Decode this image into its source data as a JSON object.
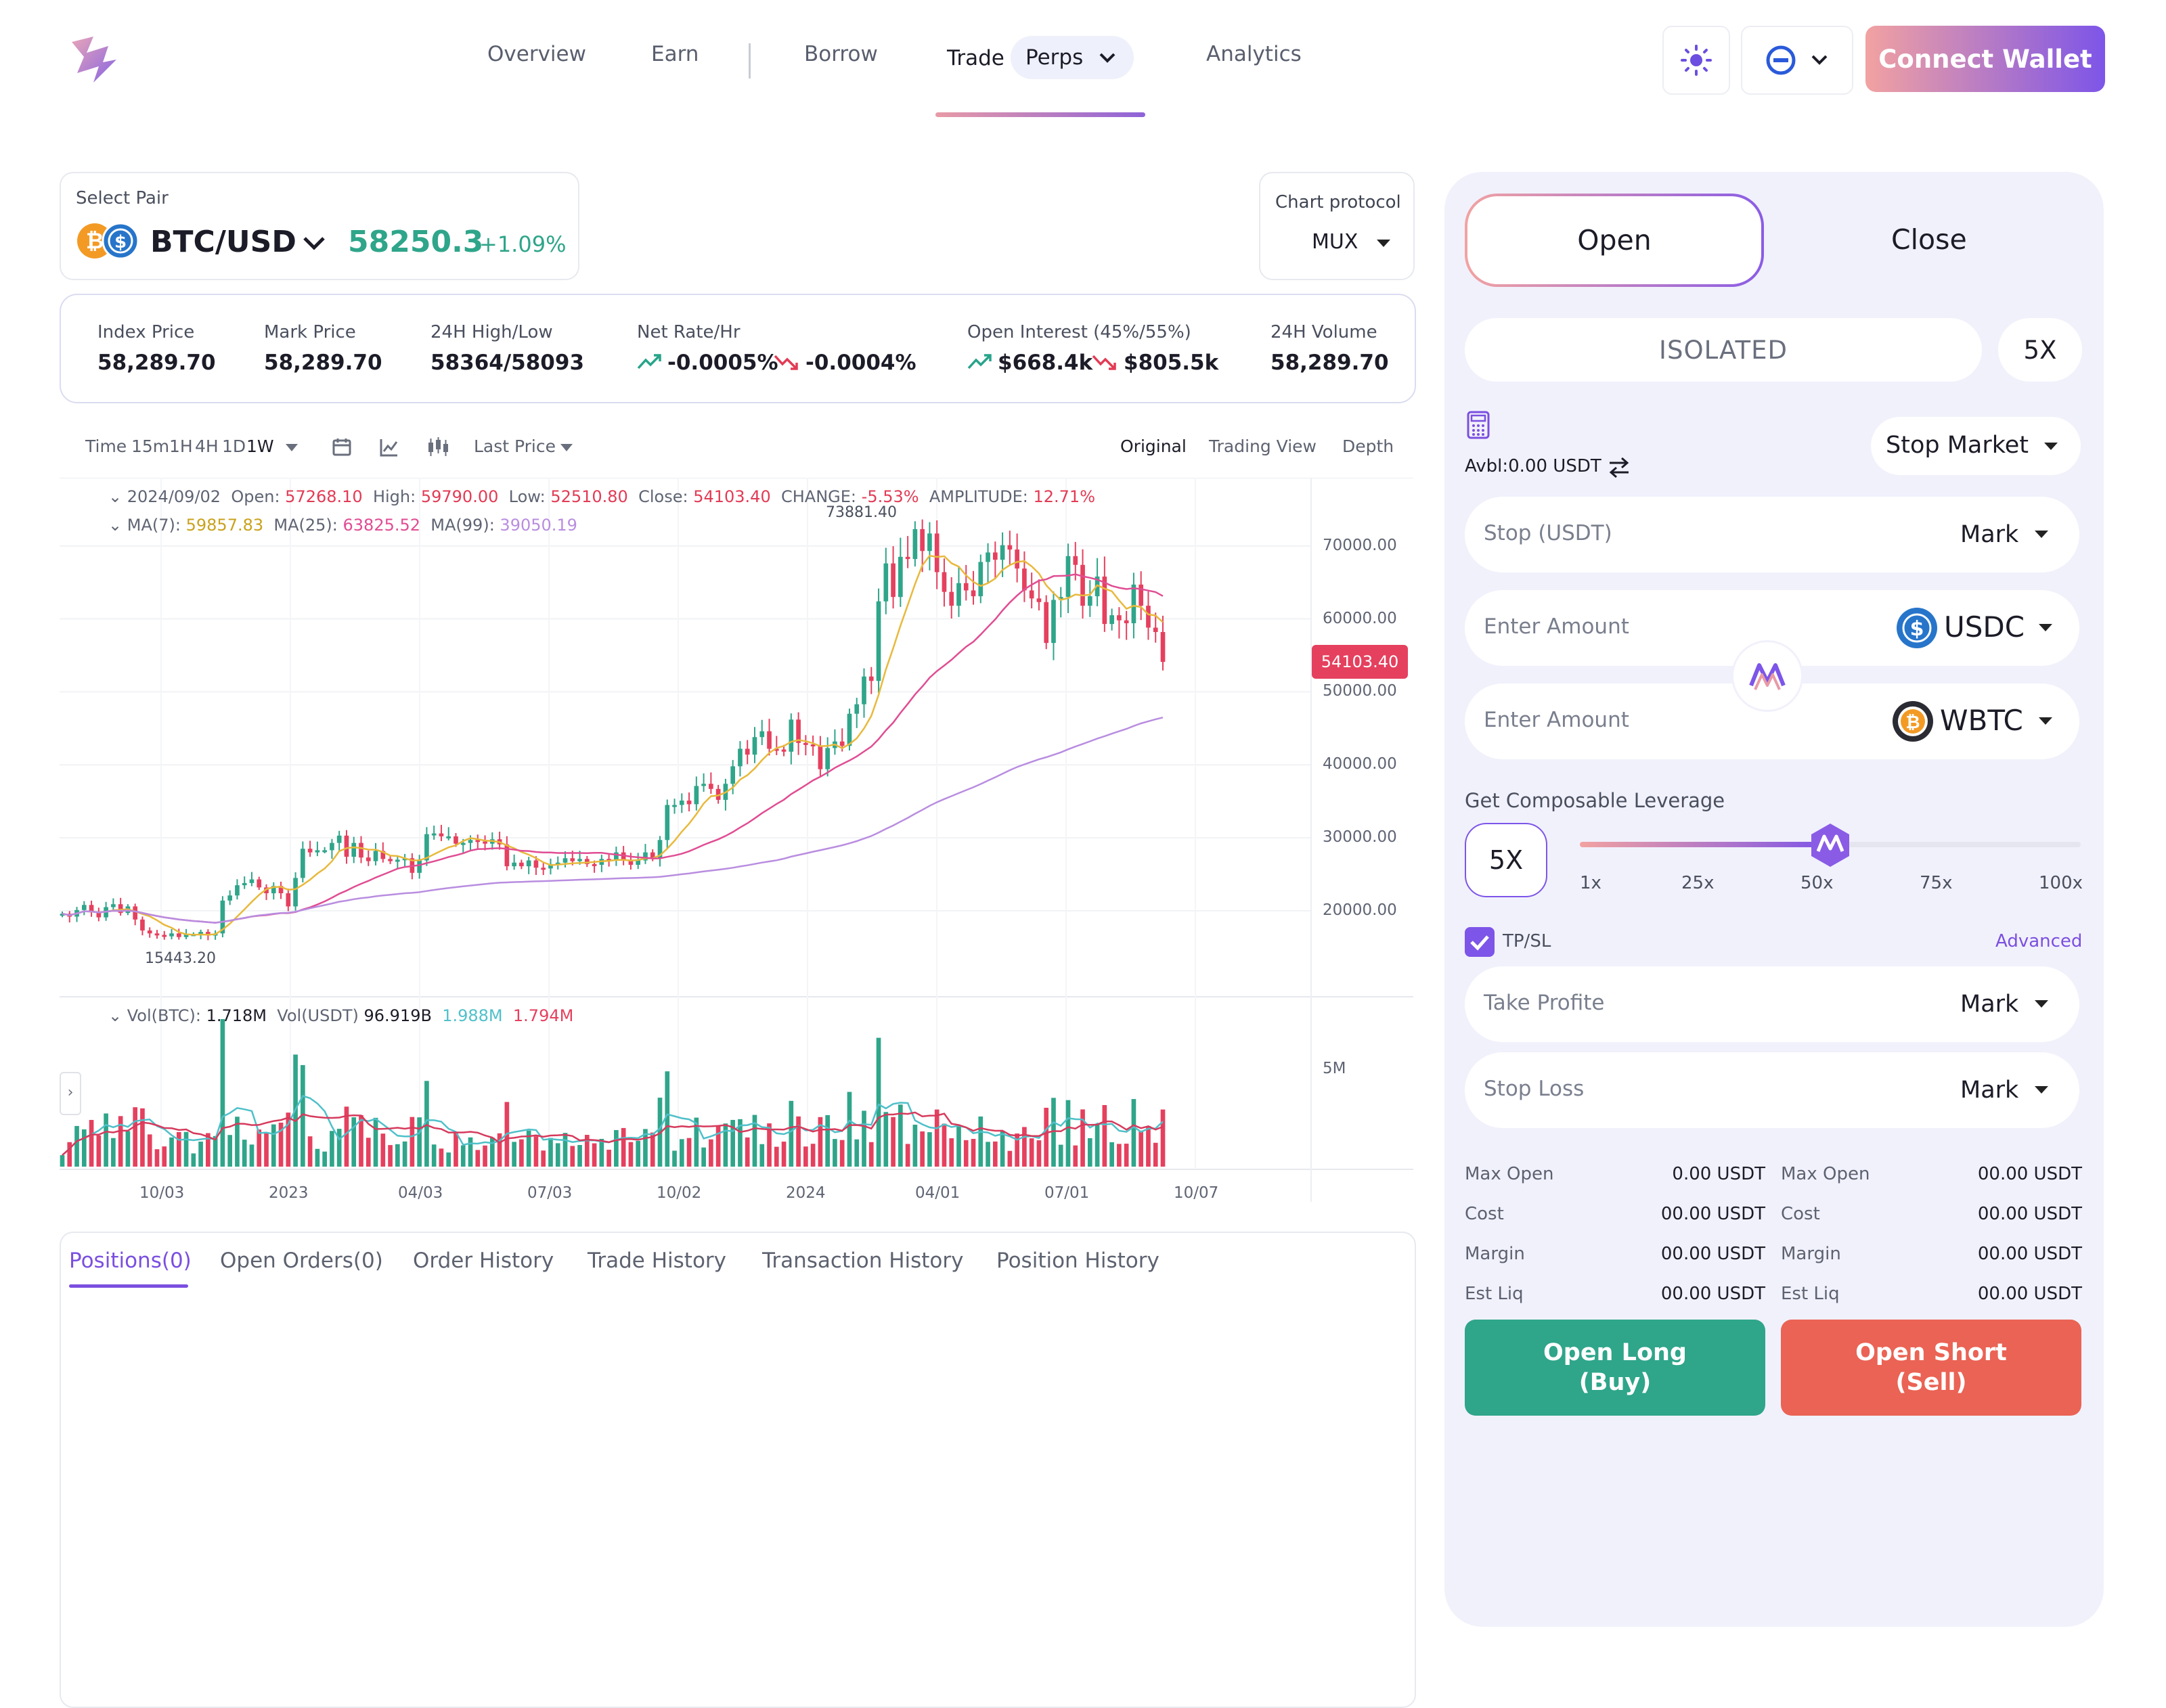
{
  "nav": {
    "items": [
      "Overview",
      "Earn",
      "Borrow",
      "Trade",
      "Analytics"
    ],
    "trade_sub": "Perps",
    "connect_label": "Connect Wallet"
  },
  "pair": {
    "select_label": "Select Pair",
    "name": "BTC/USD",
    "price": "58250.3",
    "change": "+1.09%",
    "protocol_label": "Chart protocol",
    "protocol_value": "MUX"
  },
  "stats": [
    {
      "label": "Index Price",
      "value": "58,289.70"
    },
    {
      "label": "Mark Price",
      "value": "58,289.70"
    },
    {
      "label": "24H High/Low",
      "value": "58364/58093"
    },
    {
      "label": "Net Rate/Hr",
      "up": "-0.0005%",
      "down": "-0.0004%"
    },
    {
      "label": "Open Interest (45%/55%)",
      "up": "$668.4k",
      "down": "$805.5k"
    },
    {
      "label": "24H Volume",
      "value": "58,289.70"
    }
  ],
  "toolbar": {
    "time_label": "Time",
    "intervals": [
      "15m",
      "1H",
      "4H",
      "1D",
      "1W"
    ],
    "price_type": "Last Price",
    "views": [
      "Original",
      "Trading View",
      "Depth"
    ]
  },
  "legend": {
    "date": "2024/09/02",
    "open_label": "Open:",
    "open": "57268.10",
    "high_label": "High:",
    "high": "59790.00",
    "low_label": "Low:",
    "low": "52510.80",
    "close_label": "Close:",
    "close": "54103.40",
    "change_label": "CHANGE:",
    "change": "-5.53%",
    "amp_label": "AMPLITUDE:",
    "amp": "12.71%",
    "ma7_label": "MA(7):",
    "ma7": "59857.83",
    "ma25_label": "MA(25):",
    "ma25": "63825.52",
    "ma99_label": "MA(99):",
    "ma99": "39050.19",
    "vol_btc_label": "Vol(BTC):",
    "vol_btc": "1.718M",
    "vol_usdt_label": "Vol(USDT)",
    "vol_usdt": "96.919B",
    "vol_ma1": "1.988M",
    "vol_ma2": "1.794M"
  },
  "chart_data": {
    "type": "candlestick",
    "x_labels": [
      "10/03",
      "2023",
      "04/03",
      "07/03",
      "10/02",
      "2024",
      "04/01",
      "07/01",
      "10/07"
    ],
    "y_ticks": [
      20000,
      30000,
      40000,
      50000,
      60000,
      70000
    ],
    "y_tick_labels": [
      "20000.00",
      "30000.00",
      "40000.00",
      "50000.00",
      "60000.00",
      "70000.00"
    ],
    "ylim": [
      13500,
      76000
    ],
    "current_price": "54103.40",
    "current_value": 54103.4,
    "max_label": "73881.40",
    "min_label": "15443.20",
    "vol_tick": "5M",
    "closes": [
      19600,
      19200,
      20100,
      20800,
      19800,
      19100,
      20500,
      20900,
      19700,
      20600,
      18800,
      17300,
      16900,
      16700,
      16500,
      16900,
      16400,
      16800,
      16800,
      17100,
      16600,
      16900,
      21400,
      22100,
      23500,
      23800,
      24300,
      23200,
      22400,
      23400,
      22400,
      20600,
      24500,
      28500,
      28000,
      28300,
      28300,
      29300,
      30300,
      27400,
      29300,
      27300,
      26800,
      28200,
      27100,
      26800,
      27000,
      27200,
      25200,
      26900,
      30500,
      30600,
      30200,
      30200,
      29200,
      29300,
      29700,
      29500,
      29200,
      29800,
      29100,
      26100,
      26600,
      26100,
      26900,
      25900,
      25800,
      26400,
      26600,
      27200,
      26800,
      27100,
      26400,
      26300,
      27100,
      27000,
      28000,
      27000,
      26300,
      26900,
      28000,
      27200,
      29700,
      34500,
      34500,
      35100,
      34600,
      37100,
      37400,
      36700,
      35200,
      37400,
      39800,
      42200,
      41400,
      43800,
      44600,
      42200,
      42100,
      41800,
      46200,
      43000,
      42800,
      42600,
      39400,
      42300,
      43200,
      42600,
      47000,
      48300,
      52100,
      51500,
      62400,
      67600,
      63000,
      68500,
      68200,
      72300,
      69300,
      71700,
      66400,
      63700,
      61800,
      64900,
      63900,
      63100,
      67800,
      69100,
      68100,
      70100,
      69500,
      66900,
      63900,
      62800,
      62300,
      56700,
      62600,
      63000,
      68600,
      67400,
      61800,
      63100,
      65800,
      59300,
      60500,
      59800,
      59400,
      64700,
      61800,
      58800,
      58200,
      54103
    ]
  },
  "history_tabs": [
    "Positions(0)",
    "Open Orders(0)",
    "Order History",
    "Trade History",
    "Transaction History",
    "Position History"
  ],
  "order": {
    "open_label": "Open",
    "close_label": "Close",
    "margin_mode": "ISOLATED",
    "leverage": "5X",
    "avbl": "Avbl:0.00 USDT",
    "order_type": "Stop Market",
    "stop_placeholder": "Stop (USDT)",
    "mark_label": "Mark",
    "amount_placeholder": "Enter Amount",
    "token_pay": "USDC",
    "token_receive": "WBTC",
    "composable_label": "Get Composable Leverage",
    "slider_value_label": "5X",
    "slider_marks": [
      "1x",
      "25x",
      "50x",
      "75x",
      "100x"
    ],
    "slider_fraction": 0.5,
    "tpsl_label": "TP/SL",
    "tpsl_checked": true,
    "advanced_label": "Advanced",
    "take_profit_placeholder": "Take Profite",
    "stop_loss_placeholder": "Stop Loss",
    "summary_left": [
      {
        "label": "Max Open",
        "value": "0.00 USDT"
      },
      {
        "label": "Cost",
        "value": "00.00 USDT"
      },
      {
        "label": "Margin",
        "value": "00.00 USDT"
      },
      {
        "label": "Est Liq",
        "value": "00.00 USDT"
      }
    ],
    "summary_right": [
      {
        "label": "Max Open",
        "value": "00.00 USDT"
      },
      {
        "label": "Cost",
        "value": "00.00 USDT"
      },
      {
        "label": "Margin",
        "value": "00.00 USDT"
      },
      {
        "label": "Est Liq",
        "value": "00.00 USDT"
      }
    ],
    "long_label_1": "Open Long",
    "long_label_2": "(Buy)",
    "short_label_1": "Open Short",
    "short_label_2": "(Sell)"
  },
  "colors": {
    "green": "#2fa58a",
    "red": "#e5405e",
    "accent": "#7d55e8",
    "ma7": "#e8b93c",
    "ma25": "#e04d93",
    "ma99": "#b98de0"
  }
}
